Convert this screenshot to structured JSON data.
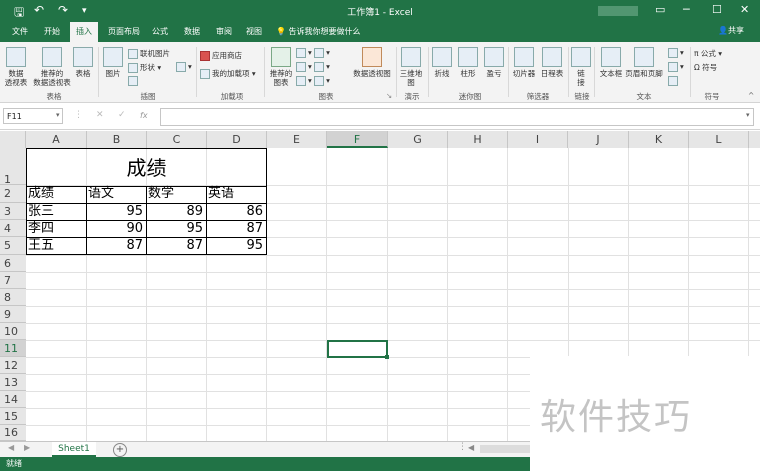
{
  "titlebar": {
    "title": "工作簿1 - Excel"
  },
  "tabs": [
    "文件",
    "开始",
    "插入",
    "页面布局",
    "公式",
    "数据",
    "审阅",
    "视图"
  ],
  "tellme": "告诉我你想要做什么",
  "share": "共享",
  "ribbon": {
    "pivot": "数据\n透视表",
    "recommended_pivot": "推荐的\n数据透视表",
    "table": "表格",
    "pictures": "图片",
    "online_pictures": "联机图片",
    "shapes": "形状",
    "app_store": "应用商店",
    "my_addins": "我的加载项",
    "recommended_charts": "推荐的\n图表",
    "pivot_chart": "数据透视图",
    "map_3d": "三维地\n图",
    "line": "折线",
    "column": "柱形",
    "winloss": "盈亏",
    "slicer": "切片器",
    "timeline": "日程表",
    "link": "链\n接",
    "textbox": "文本框",
    "header_footer": "页眉和页脚",
    "formula": "公式",
    "symbol": "符号",
    "groups": [
      "表格",
      "插图",
      "加载项",
      "图表",
      "演示",
      "迷你图",
      "筛选器",
      "链接",
      "文本",
      "符号"
    ]
  },
  "formula_bar": {
    "namebox": "F11",
    "fx": "fx",
    "value": ""
  },
  "columns": [
    "A",
    "B",
    "C",
    "D",
    "E",
    "F",
    "G",
    "H",
    "I",
    "J",
    "K",
    "L"
  ],
  "rows": [
    "1",
    "2",
    "3",
    "4",
    "5",
    "6",
    "7",
    "8",
    "9",
    "10",
    "11",
    "12",
    "13",
    "14",
    "15",
    "16"
  ],
  "sheet": {
    "title": "成绩",
    "headers": [
      "成绩",
      "语文",
      "数学",
      "英语"
    ],
    "data": [
      {
        "name": "张三",
        "values": [
          "95",
          "89",
          "86"
        ]
      },
      {
        "name": "李四",
        "values": [
          "90",
          "95",
          "87"
        ]
      },
      {
        "name": "王五",
        "values": [
          "87",
          "87",
          "95"
        ]
      }
    ]
  },
  "sheet_tab": "Sheet1",
  "status": "就绪",
  "watermark": "软件技巧",
  "colors": {
    "accent": "#217346"
  }
}
